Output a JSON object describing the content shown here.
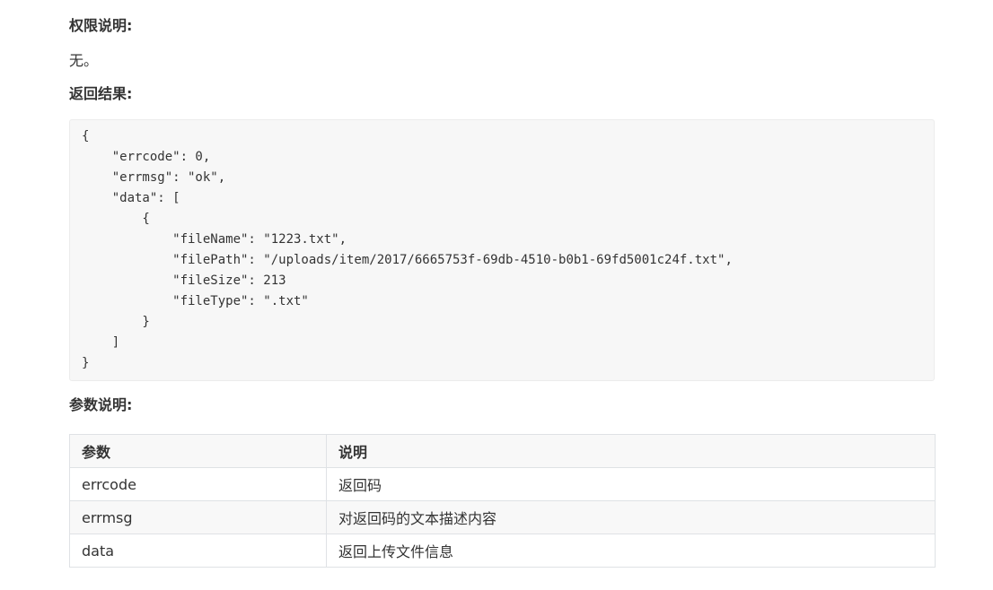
{
  "sections": {
    "permission_heading": "权限说明:",
    "permission_text": "无。",
    "result_heading": "返回结果:",
    "params_heading": "参数说明:"
  },
  "code_lines": [
    "{",
    "    \"errcode\": 0,",
    "    \"errmsg\": \"ok\",",
    "    \"data\": [",
    "        {",
    "            \"fileName\": \"1223.txt\",",
    "            \"filePath\": \"/uploads/item/2017/6665753f-69db-4510-b0b1-69fd5001c24f.txt\",",
    "            \"fileSize\": 213",
    "            \"fileType\": \".txt\"",
    "        }",
    "    ]",
    "}"
  ],
  "table": {
    "headers": [
      "参数",
      "说明"
    ],
    "rows": [
      [
        "errcode",
        "返回码"
      ],
      [
        "errmsg",
        "对返回码的文本描述内容"
      ],
      [
        "data",
        "返回上传文件信息"
      ]
    ]
  }
}
